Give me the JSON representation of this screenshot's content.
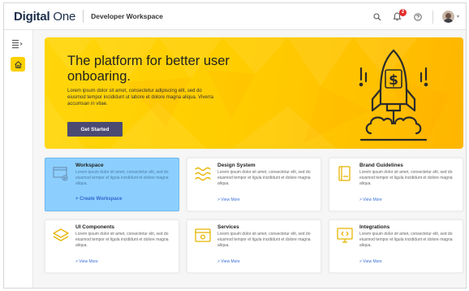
{
  "header": {
    "brand_main": "Digital",
    "brand_sub": "One",
    "product": "Developer Workspace",
    "notification_count": "2"
  },
  "sidebar": {
    "icons": [
      "menu-collapse-icon",
      "home-icon"
    ]
  },
  "hero": {
    "title": "The platform for better user onboaring.",
    "description": "Lorem ipsum dolor sit amet, consectetur adipiscing elit, sed do eiusmod tempor incididunt ut labore et dolore magna aliqua. Viverra accumsan in vitae.",
    "button": "Get Started"
  },
  "cards": [
    {
      "title": "Workspace",
      "description": "Lorem ipsum dolor sit amet, consectetur elit, sed do eiusmod tempor et ligula incididunt et dolore magna aliqua.",
      "link": "+ Create Workspace",
      "icon": "workspace-icon"
    },
    {
      "title": "Design System",
      "description": "Lorem ipsum dolor sit amet, consectetur elit, sed do eiusmod tempor et ligula incididunt et dolore magna aliqua.",
      "link": "> View More",
      "icon": "design-system-icon"
    },
    {
      "title": "Brand Guidelines",
      "description": "Lorem ipsum dolor sit amet, consectetur elit, sed do eiusmod tempor et ligula incididunt et dolore magna aliqua.",
      "link": "> View More",
      "icon": "brand-guidelines-icon"
    },
    {
      "title": "UI Components",
      "description": "Lorem ipsum dolor sit amet, consectetur elit, sed do eiusmod tempor et ligula incididunt et dolore magna aliqua.",
      "link": "> View More",
      "icon": "ui-components-icon"
    },
    {
      "title": "Services",
      "description": "Lorem ipsum dolor sit amet, consectetur elit, sed do eiusmod tempor et ligula incididunt et dolore magna aliqua.",
      "link": "> View More",
      "icon": "services-icon"
    },
    {
      "title": "Integrations",
      "description": "Lorem ipsum dolor sit amet, consectetur elit, sed do eiusmod tempor et ligula incididunt et dolore magna aliqua.",
      "link": "> View More",
      "icon": "integrations-icon"
    }
  ],
  "colors": {
    "accent": "#fbd100",
    "brand_navy": "#1a2d4a",
    "button": "#4b4a73",
    "active_card": "#8ccfff",
    "link": "#3a6fd6",
    "badge": "#e32b2b"
  }
}
